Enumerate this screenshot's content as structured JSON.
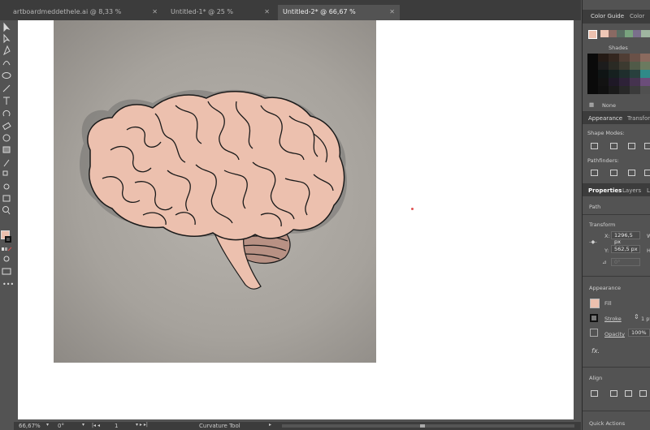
{
  "tabs": [
    {
      "label": "artboardmeddethele.ai @ 8,33 % (RGB/Preview)",
      "close": "✕"
    },
    {
      "label": "Untitled-1* @ 25 % (RGB/Preview)",
      "close": "✕"
    },
    {
      "label": "Untitled-2* @ 66,67 % (RGB/Preview)",
      "close": "✕"
    }
  ],
  "status": {
    "zoom": "66,67%",
    "rotation": "0°",
    "artboard": "1",
    "tool": "Curvature Tool"
  },
  "panel": {
    "tabs": [
      "Color Guide",
      "Color"
    ],
    "shades_label": "Shades",
    "none_label": "None",
    "appearance_tabs": [
      "Appearance",
      "Transform"
    ],
    "shape_modes_label": "Shape Modes:",
    "pathfinders_label": "Pathfinders:",
    "props_tabs": [
      "Properties",
      "Layers",
      "L"
    ],
    "path_label": "Path",
    "transform_label": "Transform",
    "x_label": "X:",
    "x_value": "1296,5 px",
    "y_label": "Y:",
    "y_value": "562,5 px",
    "w_label": "W",
    "h_label": "H",
    "angle_label": "⊿",
    "angle_value": "0°",
    "appearance_label": "Appearance",
    "fill_label": "Fill",
    "stroke_label": "Stroke",
    "stroke_value": "1 pt",
    "opacity_label": "Opacity",
    "opacity_value": "100%",
    "fx_label": "fx.",
    "align_label": "Align",
    "quick_actions_label": "Quick Actions"
  },
  "colors": {
    "brain_fill": "#ecc0ae",
    "brain_stroke": "#1a1a1a",
    "cerebellum": "#b89184",
    "fill_swatch": "#ecc0ae",
    "accent_dot": "#e05050"
  },
  "color_guide": {
    "base": "#ecc0ae",
    "harmony": [
      "#efc7b6",
      "#8a6a63",
      "#5a6e63",
      "#79a37e",
      "#7a6f8c",
      "#9fb5a0"
    ],
    "shade_rows": [
      [
        "#0a0a0a",
        "#241a15",
        "#33261f",
        "#4f3d34",
        "#6a5148",
        "#8b6a5e"
      ],
      [
        "#0a0a0a",
        "#1c1c1c",
        "#2a2a24",
        "#3c3a30",
        "#505a48",
        "#6b7a5f"
      ],
      [
        "#0a0a0a",
        "#0f1414",
        "#16201f",
        "#1f2e2d",
        "#28403d",
        "#2f8a88"
      ],
      [
        "#0a0a0a",
        "#121212",
        "#1e1826",
        "#2e2238",
        "#45334f",
        "#6b4d7a"
      ],
      [
        "#0a0a0a",
        "#101010",
        "#1a1a1a",
        "#282828",
        "#3a3a3a",
        "#505050"
      ]
    ]
  },
  "tool_icons": [
    "selection-tool-icon",
    "direct-selection-tool-icon",
    "pen-tool-icon",
    "curvature-tool-icon",
    "ellipse-tool-icon",
    "paintbrush-tool-icon",
    "type-tool-icon",
    "rotate-tool-icon",
    "eraser-tool-icon",
    "shape-builder-tool-icon",
    "gradient-tool-icon",
    "eyedropper-tool-icon",
    "blend-tool-icon",
    "symbol-sprayer-tool-icon",
    "artboard-tool-icon",
    "zoom-tool-icon",
    "hand-tool-icon"
  ]
}
